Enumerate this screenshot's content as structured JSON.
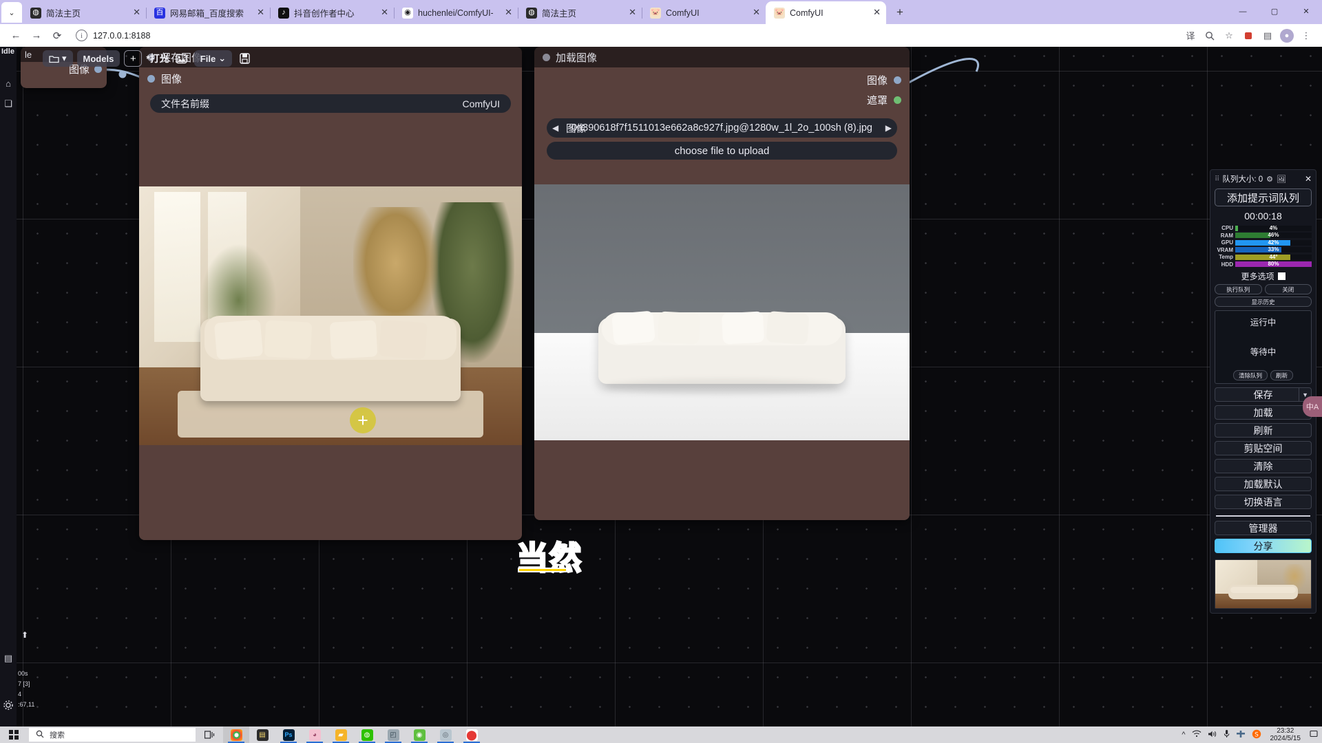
{
  "browser": {
    "tabs": [
      {
        "title": "简法主页",
        "favicon": "dark-circle-icon",
        "active": false
      },
      {
        "title": "网易邮箱_百度搜索",
        "favicon": "baidu-icon",
        "active": false
      },
      {
        "title": "抖音创作者中心",
        "favicon": "douyin-icon",
        "active": false
      },
      {
        "title": "huchenlei/ComfyUI-IC-Light·",
        "favicon": "github-icon",
        "active": false
      },
      {
        "title": "简法主页",
        "favicon": "dark-circle-icon",
        "active": false
      },
      {
        "title": "ComfyUI",
        "favicon": "comfyui-icon",
        "active": false
      },
      {
        "title": "ComfyUI",
        "favicon": "comfyui-icon",
        "active": true
      }
    ],
    "tab_close_label": "✕",
    "new_tab_label": "+",
    "tab_list_label": "⌄",
    "window_controls": {
      "minimize": "—",
      "maximize": "▢",
      "close": "✕"
    },
    "toolbar": {
      "back": "←",
      "forward": "→",
      "reload": "⟳",
      "site_info": "i",
      "url": "127.0.0.1:8188",
      "translate": "译",
      "zoom": "🔍",
      "bookmark": "☆",
      "extensions": "⬤",
      "sidepanel": "▤",
      "profile": "●",
      "menu": "⋮"
    }
  },
  "comfy_menu": {
    "status_badge": "Idle",
    "folder_label": "▾",
    "folder_icon": "folder-icon",
    "models_label": "Models",
    "add_label": "+",
    "workflow_name": "*打光",
    "image_icon": "image-icon",
    "file_label": "File",
    "file_caret": "⌄",
    "save_icon": "save-icon"
  },
  "left_rail": {
    "home_icon": "home-icon",
    "nodes_icon": "nodes-icon",
    "arrow_icon": "arrow-up-icon",
    "list_icon": "list-icon",
    "settings_icon": "gear-icon"
  },
  "nodes": {
    "save_image": {
      "title": "保存图像",
      "output_label": "图像",
      "widget_label": "文件名前缀",
      "widget_value": "ComfyUI"
    },
    "load_image": {
      "title": "加载图像",
      "outputs": [
        {
          "label": "图像",
          "color": "blue"
        },
        {
          "label": "遮罩",
          "color": "green"
        }
      ],
      "combo_label": "图像",
      "combo_value": "0a390618f7f1511013e662a8c927f.jpg@1280w_1l_2o_100sh (8).jpg",
      "combo_prev": "◀",
      "combo_next": "▶",
      "upload_button": "choose file to upload"
    },
    "partial_node": {
      "title": "le",
      "output_label": "图像"
    }
  },
  "canvas_overlay": {
    "watermark": "当然",
    "cursor": "+",
    "bottom_left": [
      "00s",
      "7 [3]",
      "4",
      ":67,11"
    ]
  },
  "queue_panel": {
    "title": "队列大小: 0",
    "drag_icon": "drag-handle-icon",
    "gear_icon": "gear-icon",
    "image_icon": "image-icon",
    "close_icon": "close-icon",
    "prompt_button": "添加提示词队列",
    "timer": "00:00:18",
    "stats": [
      {
        "label": "CPU",
        "value": "4%",
        "percent": 4,
        "color": "#4caf50"
      },
      {
        "label": "RAM",
        "value": "46%",
        "percent": 46,
        "color": "#2e7d32"
      },
      {
        "label": "GPU",
        "value": "42%",
        "percent": 42,
        "color": "#2196f3"
      },
      {
        "label": "VRAM",
        "value": "33%",
        "percent": 33,
        "color": "#1565c0"
      },
      {
        "label": "Temp",
        "value": "44°",
        "percent": 44,
        "color": "#9e9d24"
      },
      {
        "label": "HDD",
        "value": "80%",
        "percent": 80,
        "color": "#9c27b0"
      }
    ],
    "more_options": "更多选项",
    "exec_queue": "执行队列",
    "close_btn": "关闭",
    "show_history": "显示历史",
    "running_label": "运行中",
    "pending_label": "等待中",
    "clear_queue": "清除队列",
    "refresh_queue": "刷新",
    "buttons": [
      {
        "label": "保存",
        "caret": "▼"
      },
      {
        "label": "加载",
        "caret": ""
      },
      {
        "label": "刷新",
        "caret": ""
      },
      {
        "label": "剪贴空间",
        "caret": ""
      },
      {
        "label": "清除",
        "caret": ""
      },
      {
        "label": "加载默认",
        "caret": ""
      },
      {
        "label": "切换语言",
        "caret": ""
      }
    ],
    "manager_button": "管理器",
    "share_button": "分享"
  },
  "translate_bubble": "中A",
  "taskbar": {
    "start_icon": "windows-logo-icon",
    "search_placeholder": "搜索",
    "search_icon": "search-icon",
    "taskview_icon": "task-view-icon",
    "apps": [
      {
        "name": "chrome-icon",
        "glyph": "◉",
        "color": "#ffffff",
        "active": true
      },
      {
        "name": "notepad-icon",
        "glyph": "▤",
        "color": "#2b2b2b",
        "active": false
      },
      {
        "name": "photoshop-icon",
        "glyph": "Ps",
        "color": "#001e36",
        "active": false
      },
      {
        "name": "anime-app-icon",
        "glyph": "◕",
        "color": "#f4c0d0",
        "active": false
      },
      {
        "name": "explorer-icon",
        "glyph": "▰",
        "color": "#f5b429",
        "active": false
      },
      {
        "name": "wechat-icon",
        "glyph": "◍",
        "color": "#2dc100",
        "active": false
      },
      {
        "name": "monitor-icon",
        "glyph": "◰",
        "color": "#9aa7b0",
        "active": false
      },
      {
        "name": "comfy-app-icon",
        "glyph": "◉",
        "color": "#5fbf3f",
        "active": false
      },
      {
        "name": "disc-icon",
        "glyph": "◎",
        "color": "#b9c6cf",
        "active": false
      },
      {
        "name": "record-icon",
        "glyph": "⬤",
        "color": "#e53935",
        "active": false
      }
    ],
    "tray": {
      "chevron": "^",
      "wifi": "wifi-icon",
      "volume": "volume-icon",
      "mic": "mic-icon",
      "ime": "ime-icon",
      "sogou": "sogou-icon",
      "time": "23:32",
      "date": "2024/5/15"
    }
  }
}
